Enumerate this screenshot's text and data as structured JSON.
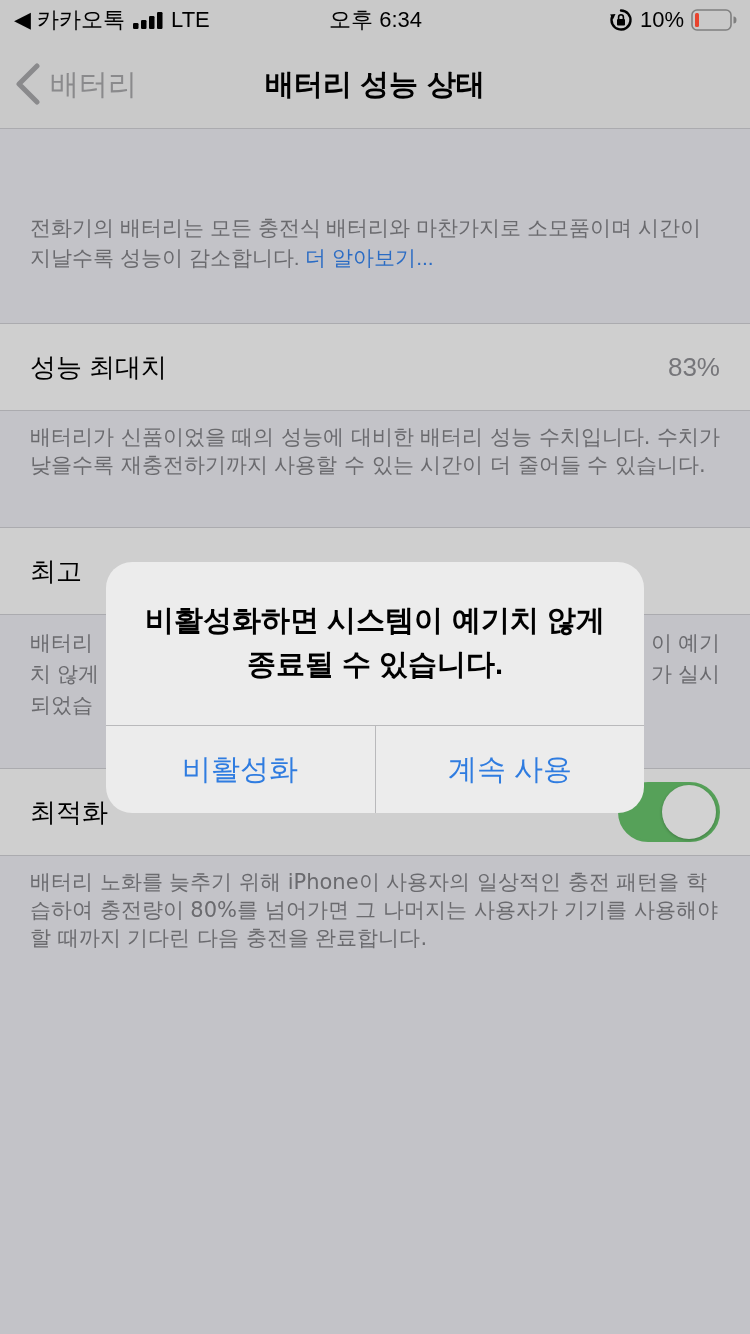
{
  "status_bar": {
    "back_app": "◀ 카카오톡",
    "network": "LTE",
    "time": "오후 6:34",
    "battery": "10%"
  },
  "nav": {
    "back": "배터리",
    "title": "배터리 성능 상태"
  },
  "intro": {
    "text": "전화기의 배터리는 모든 충전식 배터리와 마찬가지로 소모품이며 시간이 지날수록 성능이 감소합니다.",
    "link": "더 알아보기..."
  },
  "sections": [
    {
      "kind": "value",
      "label": "성능 최대치",
      "value": "83%",
      "footer": "배터리가 신품이었을 때의 성능에 대비한 배터리 성능 수치입니다. 수치가 낮을수록 재충전하기까지 사용할 수 있는 시간이 더 줄어들 수 있습니다."
    },
    {
      "kind": "plain",
      "label": "최고",
      "footer_left": [
        "배터리",
        "치 않게",
        "되었습"
      ],
      "footer_right": [
        "이 예기",
        "가 실시"
      ]
    },
    {
      "kind": "toggle",
      "label": "최적화",
      "on": true,
      "footer": "배터리 노화를 늦추기 위해 iPhone이 사용자의 일상적인 충전 패턴을 학습하여 충전량이 80%를 넘어가면 그 나머지는 사용자가 기기를 사용해야 할 때까지 기다린 다음 충전을 완료합니다."
    }
  ],
  "alert": {
    "message": "비활성화하면 시스템이 예기치 않게 종료될 수 있습니다.",
    "buttons": [
      {
        "label": "비활성화"
      },
      {
        "label": "계속 사용"
      }
    ]
  }
}
